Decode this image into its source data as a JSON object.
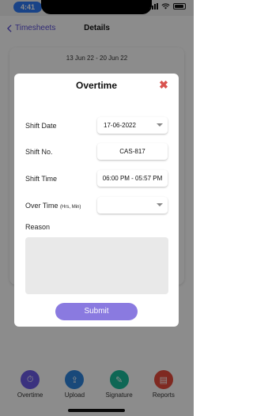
{
  "status_bar": {
    "time": "4:41"
  },
  "nav": {
    "back_label": "Timesheets",
    "title": "Details"
  },
  "background": {
    "date_range": "13 Jun 22 - 20 Jun 22"
  },
  "bottom_tabs": [
    {
      "label": "Overtime",
      "icon": "overtime-icon",
      "color": "#6c5ce7"
    },
    {
      "label": "Upload",
      "icon": "upload-icon",
      "color": "#2e86de"
    },
    {
      "label": "Signature",
      "icon": "signature-icon",
      "color": "#1abc9c"
    },
    {
      "label": "Reports",
      "icon": "reports-icon",
      "color": "#e74c3c"
    }
  ],
  "modal": {
    "title": "Overtime",
    "fields": {
      "shift_date": {
        "label": "Shift Date",
        "value": "17-06-2022"
      },
      "shift_no": {
        "label": "Shift No.",
        "value": "CAS-817"
      },
      "shift_time": {
        "label": "Shift Time",
        "value": "06:00 PM - 05:57 PM"
      },
      "over_time": {
        "label": "Over Time",
        "unit": "(Hrs, Min)",
        "value": ""
      }
    },
    "reason_label": "Reason",
    "reason_value": "",
    "submit_label": "Submit",
    "colors": {
      "accent": "#8a7ae0",
      "close": "#d9534f"
    }
  }
}
